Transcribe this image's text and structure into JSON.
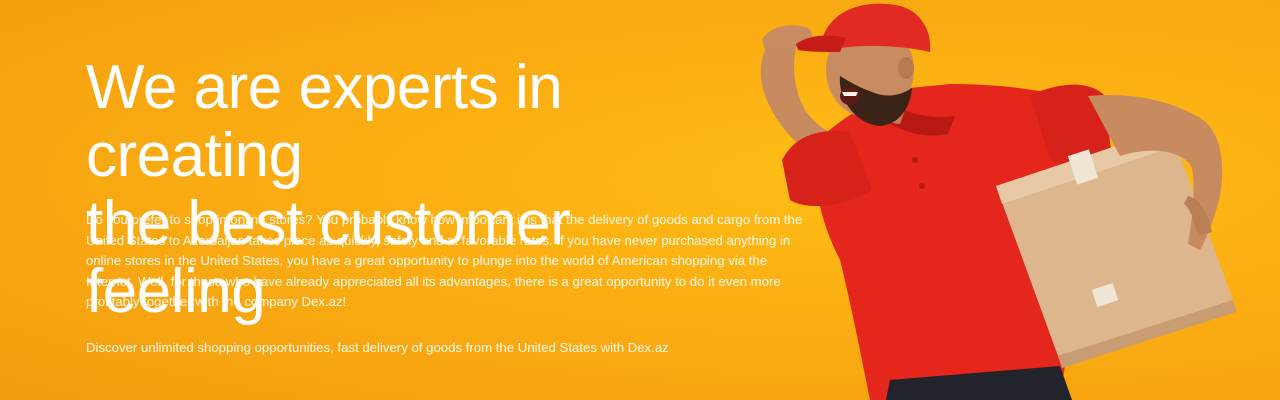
{
  "banner": {
    "headline_line1": "We are experts in creating",
    "headline_line2": "the best customer feeling",
    "body": "Do you prefer to shop in online stores? You probably know how important it is that the delivery of goods and cargo from the United States to Azerbaijan takes place as quickly, safely and at favorable rates. If you have never purchased anything in online stores in the United States, you have a great opportunity to plunge into the world of American shopping via the Internet. Well, for those who have already appreciated all its advantages, there is a great opportunity to do it even more profitably together with the company Dex.az!",
    "tagline": "Discover unlimited shopping opportunities, fast delivery of goods from the United States with Dex.az"
  },
  "colors": {
    "background": "#fbad12",
    "shirt": "#e8251d",
    "cap": "#e02a22",
    "box": "#dcb48c",
    "text": "#ffffff"
  },
  "image": {
    "subject": "courier-with-box"
  }
}
